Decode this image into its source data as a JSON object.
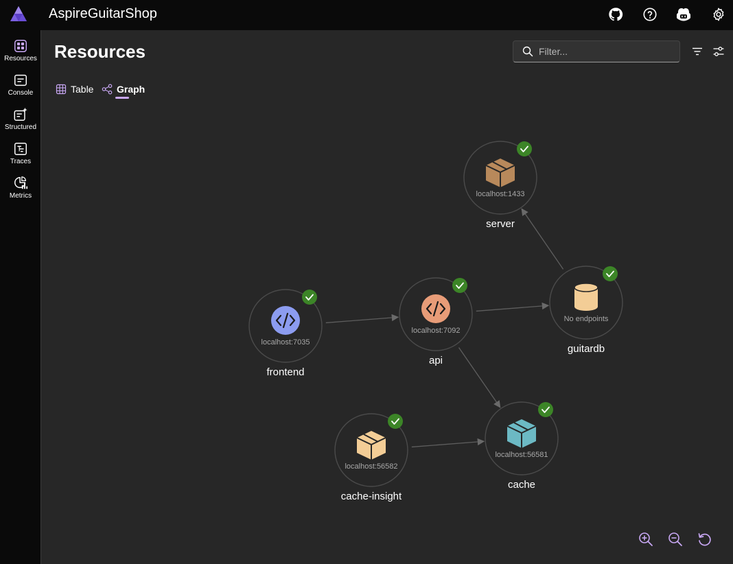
{
  "app": {
    "title": "AspireGuitarShop"
  },
  "header_icons": [
    "github-icon",
    "help-icon",
    "copilot-icon",
    "settings-icon"
  ],
  "nav": {
    "items": [
      {
        "label": "Resources",
        "icon": "resources-icon"
      },
      {
        "label": "Console",
        "icon": "console-icon"
      },
      {
        "label": "Structured",
        "icon": "structured-logs-icon"
      },
      {
        "label": "Traces",
        "icon": "traces-icon"
      },
      {
        "label": "Metrics",
        "icon": "metrics-icon"
      }
    ]
  },
  "page": {
    "title": "Resources",
    "filter_placeholder": "Filter...",
    "tabs": [
      {
        "label": "Table",
        "active": false
      },
      {
        "label": "Graph",
        "active": true
      }
    ]
  },
  "graph": {
    "nodes": [
      {
        "id": "server",
        "name": "server",
        "endpoint": "localhost:1433",
        "icon": "container-icon",
        "icon_color": "#b8895b",
        "status": "running"
      },
      {
        "id": "frontend",
        "name": "frontend",
        "endpoint": "localhost:7035",
        "icon": "project-icon",
        "icon_color": "#8c9cf0",
        "status": "running"
      },
      {
        "id": "api",
        "name": "api",
        "endpoint": "localhost:7092",
        "icon": "project-icon",
        "icon_color": "#e89c78",
        "status": "running"
      },
      {
        "id": "guitardb",
        "name": "guitardb",
        "endpoint": "No endpoints",
        "icon": "database-icon",
        "icon_color": "#f3cd96",
        "status": "running"
      },
      {
        "id": "cache-insight",
        "name": "cache-insight",
        "endpoint": "localhost:56582",
        "icon": "container-icon",
        "icon_color": "#f3cd96",
        "status": "running"
      },
      {
        "id": "cache",
        "name": "cache",
        "endpoint": "localhost:56581",
        "icon": "container-icon",
        "icon_color": "#6cb9c4",
        "status": "running"
      }
    ],
    "edges": [
      {
        "from": "frontend",
        "to": "api"
      },
      {
        "from": "api",
        "to": "guitardb"
      },
      {
        "from": "guitardb",
        "to": "server"
      },
      {
        "from": "api",
        "to": "cache"
      },
      {
        "from": "cache-insight",
        "to": "cache"
      }
    ]
  },
  "zoom_controls": [
    "zoom-in-icon",
    "zoom-out-icon",
    "reset-view-icon"
  ],
  "colors": {
    "accent": "#c9a8f5",
    "status_ok": "#3c8527",
    "background": "#272727",
    "chrome": "#0a0a0a"
  }
}
